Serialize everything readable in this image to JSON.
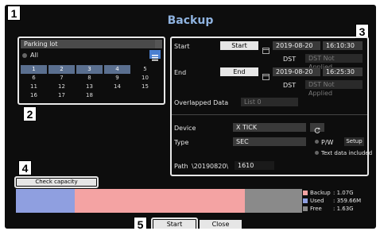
{
  "window": {
    "title": "Backup"
  },
  "callouts": [
    "1",
    "2",
    "3",
    "4",
    "5"
  ],
  "channel": {
    "selected": "Parking lot",
    "all_label": "All"
  },
  "calendar": {
    "days": [
      "1",
      "2",
      "3",
      "4",
      "5",
      "6",
      "7",
      "8",
      "9",
      "10",
      "11",
      "12",
      "13",
      "14",
      "15",
      "16",
      "17",
      "18"
    ],
    "selected_days": [
      "1",
      "2",
      "3",
      "4"
    ]
  },
  "start": {
    "label": "Start",
    "button": "Start",
    "date": "2019-08-20",
    "time": "16:10:30",
    "dst_label": "DST",
    "dst_value": "DST Not Applied"
  },
  "end": {
    "label": "End",
    "button": "End",
    "date": "2019-08-20",
    "time": "16:25:30",
    "dst_label": "DST",
    "dst_value": "DST Not Applied"
  },
  "overlapped": {
    "label": "Overlapped Data",
    "value": "List 0"
  },
  "device": {
    "label": "Device",
    "value": "X TICK"
  },
  "type": {
    "label": "Type",
    "value": "SEC",
    "pw_label": "P/W",
    "setup_label": "Setup",
    "text_data_label": "Text data included"
  },
  "path": {
    "label": "Path",
    "value": "\\20190820\\",
    "suffix": "1610"
  },
  "capacity": {
    "button": "Check capacity",
    "legend": [
      {
        "name": "Backup",
        "value": ": 1.07G",
        "color": "#f4a3a3"
      },
      {
        "name": "Used",
        "value": ": 359.66M",
        "color": "#8f9fe0"
      },
      {
        "name": "Free",
        "value": ": 1.63G",
        "color": "#8a8a8a"
      }
    ],
    "bar": {
      "used_fraction": 0.205,
      "backup_fraction": 0.595,
      "free_fraction": 0.2
    }
  },
  "footer": {
    "start": "Start",
    "close": "Close"
  }
}
